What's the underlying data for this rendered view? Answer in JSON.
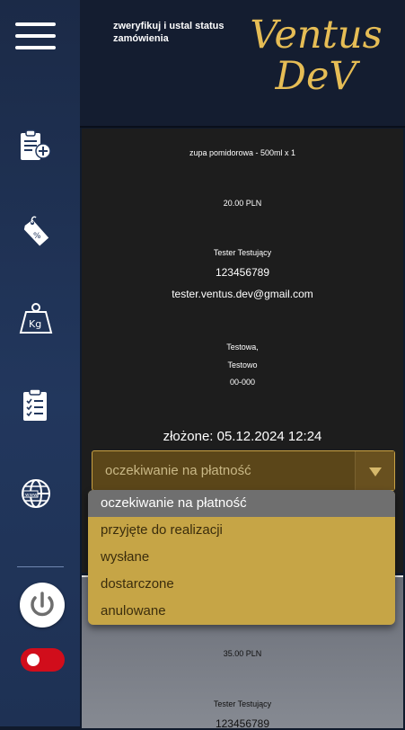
{
  "header": {
    "subtitle": "zweryfikuj i ustal status zamówienia",
    "logo_line1": "Ventus",
    "logo_line2": "DeV"
  },
  "sidebar": {
    "icons": [
      "menu-icon",
      "new-order-icon",
      "price-tag-icon",
      "weight-icon",
      "checklist-icon",
      "globe-icon",
      "power-icon"
    ],
    "toggle_on": false,
    "accent_color": "#d10d1b"
  },
  "order": {
    "item": "zupa pomidorowa - 500ml x 1",
    "price": "20.00 PLN",
    "customer_name": "Tester Testujący",
    "phone": "123456789",
    "email": "tester.ventus.dev@gmail.com",
    "street": "Testowa,",
    "city": "Testowo",
    "postal": "00-000",
    "placed": "złożone: 05.12.2024 12:24",
    "status": "oczekiwanie na płatność"
  },
  "status_options": [
    "oczekiwanie na płatność",
    "przyjęte do realizacji",
    "wysłane",
    "dostarczone",
    "anulowane"
  ],
  "next_order": {
    "price": "35.00 PLN",
    "customer_name": "Tester Testujący",
    "phone": "123456789"
  },
  "colors": {
    "gold": "#e6bd55",
    "dropdown": "#c6a546",
    "card": "#1d1d1d"
  }
}
